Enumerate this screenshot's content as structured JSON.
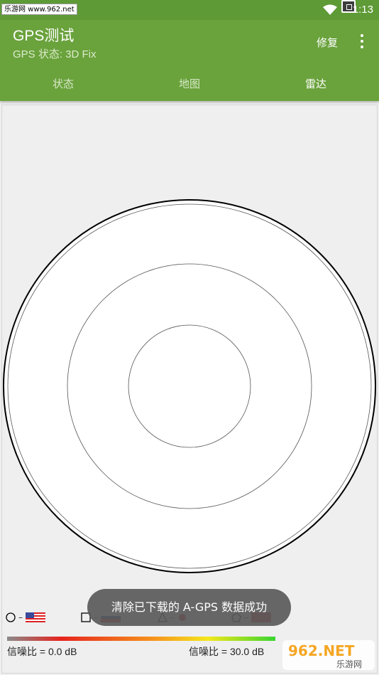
{
  "status_bar": {
    "watermark": "乐游网 www.962.net",
    "time": "1:13"
  },
  "app_bar": {
    "title": "GPS测试",
    "subtitle": "GPS 状态:  3D Fix",
    "repair_label": "修复",
    "tabs": [
      {
        "label": "状态",
        "active": false
      },
      {
        "label": "地图",
        "active": false
      },
      {
        "label": "雷达",
        "active": true
      }
    ]
  },
  "legend": {
    "dash": "–"
  },
  "snr": {
    "min_label": "信噪比 = 0.0 dB",
    "max_label": "信噪比 = 30.0 dB"
  },
  "toast": {
    "message": "清除已下载的 A-GPS 数据成功"
  },
  "watermark_bottom": {
    "brand": "962.NET",
    "site": "乐游网"
  },
  "colors": {
    "status_bar": "#5E9A35",
    "app_bar": "#6AA23C"
  }
}
